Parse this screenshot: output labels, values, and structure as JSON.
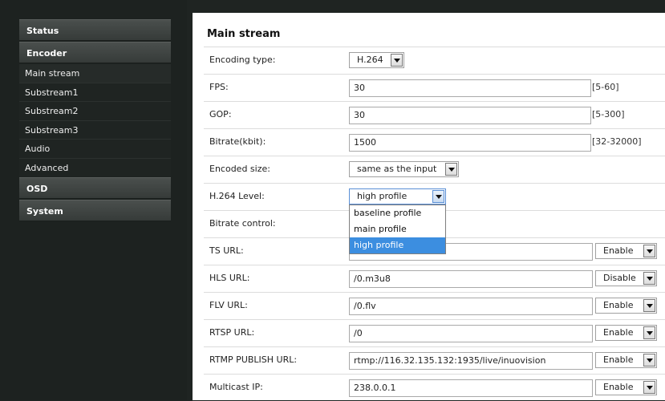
{
  "sidebar": {
    "sections": [
      {
        "label": "Status"
      },
      {
        "label": "Encoder"
      },
      {
        "label": "OSD"
      },
      {
        "label": "System"
      }
    ],
    "encoder_items": [
      {
        "label": "Main stream"
      },
      {
        "label": "Substream1"
      },
      {
        "label": "Substream2"
      },
      {
        "label": "Substream3"
      },
      {
        "label": "Audio"
      },
      {
        "label": "Advanced"
      }
    ]
  },
  "main": {
    "title": "Main stream",
    "encoding_type": {
      "label": "Encoding type:",
      "value": "H.264"
    },
    "fps": {
      "label": "FPS:",
      "value": "30",
      "range": "[5-60]"
    },
    "gop": {
      "label": "GOP:",
      "value": "30",
      "range": "[5-300]"
    },
    "bitrate": {
      "label": "Bitrate(kbit):",
      "value": "1500",
      "range": "[32-32000]"
    },
    "encoded_size": {
      "label": "Encoded size:",
      "value": "same as the input"
    },
    "h264_level": {
      "label": "H.264 Level:",
      "value": "high profile",
      "options": [
        "baseline profile",
        "main profile",
        "high profile"
      ],
      "selected_option": "high profile"
    },
    "bitrate_control": {
      "label": "Bitrate control:"
    },
    "ts_url": {
      "label": "TS URL:",
      "value": "",
      "state": "Enable"
    },
    "hls_url": {
      "label": "HLS URL:",
      "value": "/0.m3u8",
      "state": "Disable"
    },
    "flv_url": {
      "label": "FLV URL:",
      "value": "/0.flv",
      "state": "Enable"
    },
    "rtsp_url": {
      "label": "RTSP URL:",
      "value": "/0",
      "state": "Enable"
    },
    "rtmp_url": {
      "label": "RTMP PUBLISH URL:",
      "value": "rtmp://116.32.135.132:1935/live/inuovision",
      "state": "Enable"
    },
    "multicast_ip": {
      "label": "Multicast IP:",
      "value": "238.0.0.1",
      "state": "Enable"
    }
  },
  "colors": {
    "sidebar_bg": "#1d2220",
    "selection_blue": "#3c8ee0",
    "panel_bg": "#ffffff"
  }
}
